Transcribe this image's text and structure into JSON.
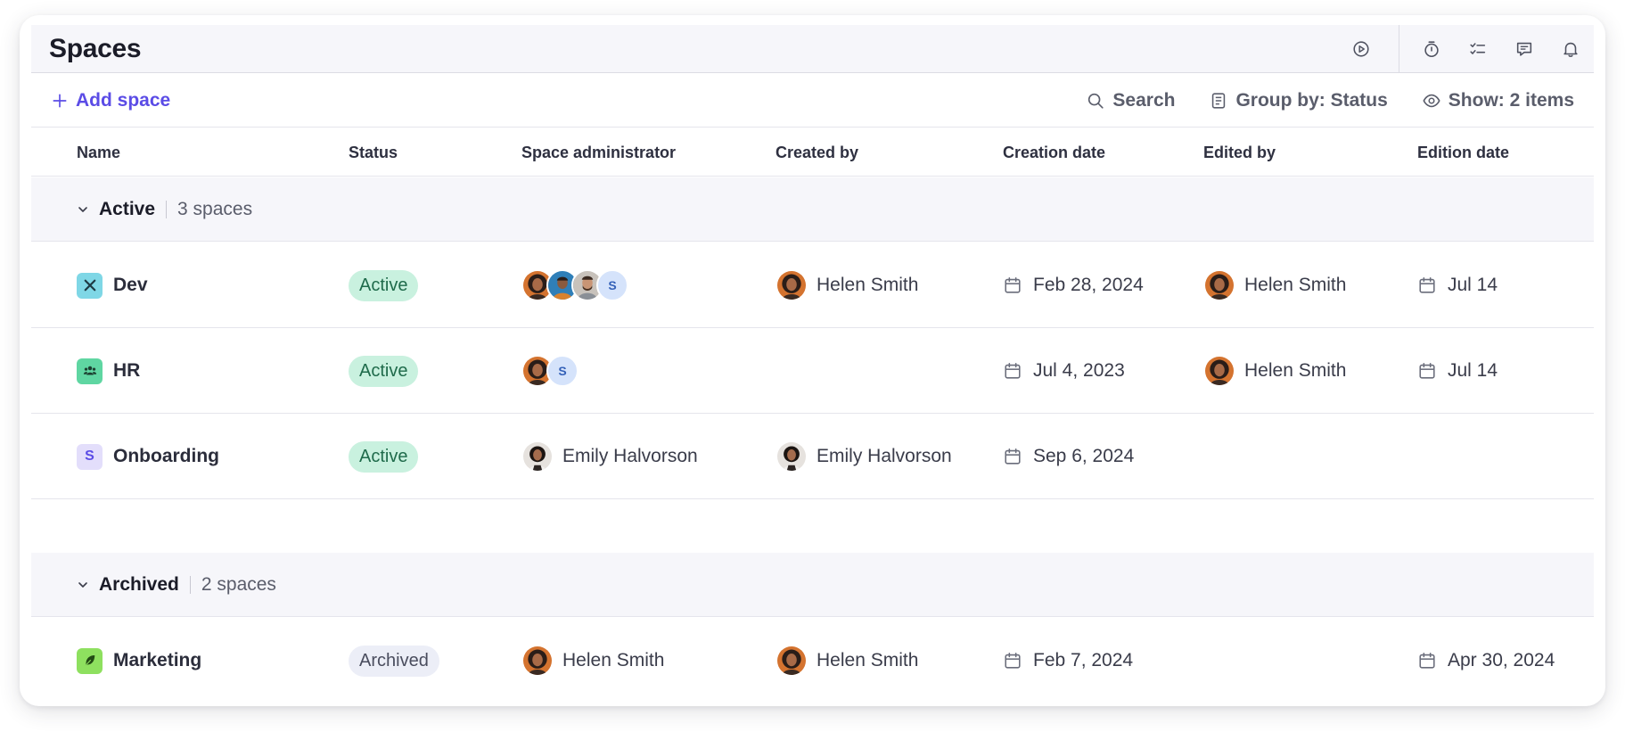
{
  "header": {
    "title": "Spaces",
    "icons": [
      "play-icon",
      "timer-icon",
      "checklist-icon",
      "comment-icon",
      "bell-icon"
    ]
  },
  "toolbar": {
    "add_label": "Add space",
    "search_label": "Search",
    "group_label": "Group by: Status",
    "show_label": "Show: 2 items"
  },
  "columns": [
    "Name",
    "Status",
    "Space administrator",
    "Created by",
    "Creation date",
    "Edited by",
    "Edition date"
  ],
  "groups": [
    {
      "name": "Active",
      "count": "3 spaces",
      "rows": [
        {
          "name": "Dev",
          "icon": "tools-icon",
          "icon_color": "#7fd7e6",
          "status": "Active",
          "admin_initial": "S",
          "created_by": "Helen Smith",
          "creation_date": "Feb 28, 2024",
          "edited_by": "Helen Smith",
          "edition_date": "Jul 14"
        },
        {
          "name": "HR",
          "icon": "people-icon",
          "icon_color": "#5fd6a2",
          "status": "Active",
          "admin_initial": "S",
          "created_by": "",
          "creation_date": "Jul 4, 2023",
          "edited_by": "Helen Smith",
          "edition_date": "Jul 14"
        },
        {
          "name": "Onboarding",
          "icon_letter": "S",
          "icon_color": "#e3defb",
          "status": "Active",
          "admin": "Emily Halvorson",
          "created_by": "Emily Halvorson",
          "creation_date": "Sep 6, 2024",
          "edited_by": "",
          "edition_date": ""
        }
      ]
    },
    {
      "name": "Archived",
      "count": "2 spaces",
      "rows": [
        {
          "name": "Marketing",
          "icon": "feather-icon",
          "icon_color": "#8ee05f",
          "status": "Archived",
          "admin": "Helen Smith",
          "created_by": "Helen Smith",
          "creation_date": "Feb 7, 2024",
          "edited_by": "",
          "edition_date": "Apr 30, 2024"
        }
      ]
    }
  ],
  "colors": {
    "accent": "#5b4ce6",
    "active_badge": "#c9f1df",
    "archived_badge": "#eceef7"
  }
}
